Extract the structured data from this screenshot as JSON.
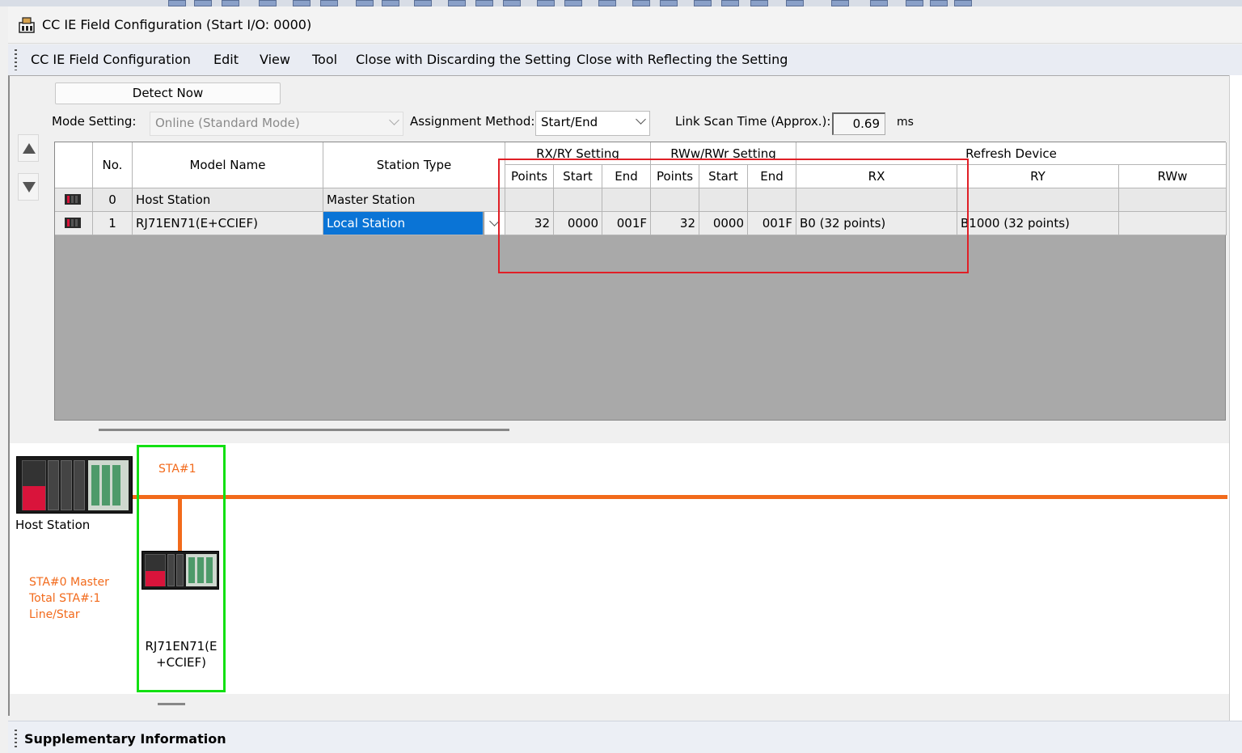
{
  "window": {
    "title": "CC IE Field Configuration (Start I/O: 0000)"
  },
  "menu": {
    "items": [
      "CC IE Field Configuration",
      "Edit",
      "View",
      "Tool",
      "Close with Discarding the Setting",
      "Close with Reflecting the Setting"
    ]
  },
  "controls": {
    "detect_now": "Detect Now",
    "mode_setting_label": "Mode Setting:",
    "mode_setting_value": "Online (Standard Mode)",
    "assignment_label": "Assignment Method:",
    "assignment_value": "Start/End",
    "link_scan_label": "Link Scan Time (Approx.):",
    "link_scan_value": "0.69",
    "link_scan_unit": "ms"
  },
  "grid": {
    "headers": {
      "no": "No.",
      "model": "Model Name",
      "station_type": "Station Type",
      "rxry": "RX/RY Setting",
      "rwwrwr": "RWw/RWr Setting",
      "refresh": "Refresh Device",
      "points": "Points",
      "start": "Start",
      "end": "End",
      "rx": "RX",
      "ry": "RY",
      "rww": "RWw"
    },
    "rows": [
      {
        "no": "0",
        "model": "Host Station",
        "station_type": "Master Station",
        "rx_points": "",
        "rx_start": "",
        "rx_end": "",
        "rw_points": "",
        "rw_start": "",
        "rw_end": "",
        "ref_rx": "",
        "ref_ry": "",
        "ref_rww": ""
      },
      {
        "no": "1",
        "model": "RJ71EN71(E+CCIEF)",
        "station_type": "Local Station",
        "rx_points": "32",
        "rx_start": "0000",
        "rx_end": "001F",
        "rw_points": "32",
        "rw_start": "0000",
        "rw_end": "001F",
        "ref_rx": "B0 (32 points)",
        "ref_ry": "B1000 (32 points)",
        "ref_rww": ""
      }
    ]
  },
  "network": {
    "host_label": "Host Station",
    "sta1_label": "STA#1",
    "info_lines": [
      "STA#0  Master",
      "Total STA#:1",
      "Line/Star"
    ],
    "node_model_line1": "RJ71EN71(E",
    "node_model_line2": "+CCIEF)",
    "line_color": "#f26a1b"
  },
  "bottom": {
    "supplementary": "Supplementary Information"
  },
  "highlight_colors": {
    "red_box": "#e01f26",
    "green_box": "#12e012"
  }
}
